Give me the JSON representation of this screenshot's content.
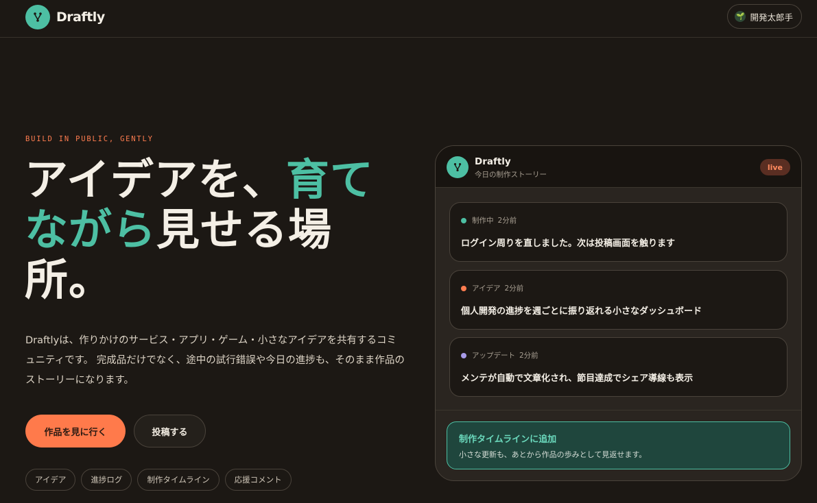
{
  "header": {
    "brand": "Draftly",
    "user_name": "開発太郎手",
    "user_avatar_icon": "plant-icon"
  },
  "hero": {
    "eyebrow": "BUILD IN PUBLIC, GENTLY",
    "headline_part1": "アイデアを、",
    "headline_accent": "育てながら",
    "headline_part2": "見せる場所。",
    "lead": "Draftlyは、作りかけのサービス・アプリ・ゲーム・小さなアイデアを共有するコミュニティです。 完成品だけでなく、途中の試行錯誤や今日の進捗も、そのまま作品のストーリーになります。",
    "primary_button": "作品を見に行く",
    "secondary_button": "投稿する",
    "tags": [
      "アイデア",
      "進捗ログ",
      "制作タイムライン",
      "応援コメント"
    ]
  },
  "card": {
    "title": "Draftly",
    "subtitle": "今日の制作ストーリー",
    "badge": "live",
    "entries": [
      {
        "category": "制作中",
        "time": "2分前",
        "text": "ログイン周りを直しました。次は投稿画面を触ります",
        "dot_color": "#4dbfa3"
      },
      {
        "category": "アイデア",
        "time": "2分前",
        "text": "個人開発の進捗を週ごとに振り返れる小さなダッシュボード",
        "dot_color": "#ff7d50"
      },
      {
        "category": "アップデート",
        "time": "2分前",
        "text": "メンテが自動で文章化され、節目達成でシェア導線も表示",
        "dot_color": "#a89be8"
      }
    ],
    "add": {
      "title": "制作タイムラインに追加",
      "description": "小さな更新も、あとから作品の歩みとして見返せます。"
    }
  },
  "colors": {
    "background": "#1c1814",
    "accent_teal": "#4dbfa3",
    "accent_orange": "#ff7a4b"
  }
}
